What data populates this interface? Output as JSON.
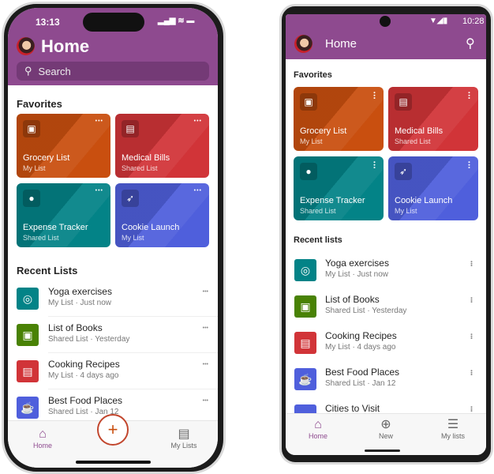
{
  "colors": {
    "brand": "#8e4a8f",
    "orange": "#c94f0f",
    "red": "#d13438",
    "teal": "#038387",
    "blue": "#4f5fdc",
    "green": "#498205"
  },
  "favorites": [
    {
      "name": "Grocery List",
      "sub": "My List",
      "color": "#c94f0f",
      "icon": "box-icon",
      "glyph": "▣"
    },
    {
      "name": "Medical Bills",
      "sub": "Shared List",
      "color": "#d13438",
      "icon": "clipboard-icon",
      "glyph": "▤"
    },
    {
      "name": "Expense Tracker",
      "sub": "Shared List",
      "color": "#038387",
      "icon": "piggy-bank-icon",
      "glyph": "●"
    },
    {
      "name": "Cookie Launch",
      "sub": "My List",
      "color": "#4f5fdc",
      "icon": "rocket-icon",
      "glyph": "➶"
    }
  ],
  "recent": [
    {
      "name": "Yoga exercises",
      "sub": "My List · Just now",
      "color": "#038387",
      "icon": "target-icon",
      "glyph": "◎"
    },
    {
      "name": "List of Books",
      "sub": "Shared List · Yesterday",
      "color": "#498205",
      "icon": "box-icon",
      "glyph": "▣"
    },
    {
      "name": "Cooking Recipes",
      "sub": "My List · 4 days ago",
      "color": "#d13438",
      "icon": "clipboard-icon",
      "glyph": "▤"
    },
    {
      "name": "Best Food Places",
      "sub": "Shared List · Jan 12",
      "color": "#4f5fdc",
      "icon": "coffee-icon",
      "glyph": "☕"
    },
    {
      "name": "Cities to Visit",
      "sub": "",
      "color": "#4f5fdc",
      "icon": "city-icon",
      "glyph": "⌂"
    }
  ],
  "ios": {
    "time": "13:13",
    "title": "Home",
    "search_placeholder": "Search",
    "favorites_label": "Favorites",
    "recent_label": "Recent Lists",
    "nav": {
      "home": "Home",
      "new": "+",
      "mylists": "My Lists"
    }
  },
  "android": {
    "time": "10:28",
    "title": "Home",
    "favorites_label": "Favorites",
    "recent_label": "Recent lists",
    "nav": {
      "home": "Home",
      "new": "New",
      "mylists": "My lists"
    }
  }
}
